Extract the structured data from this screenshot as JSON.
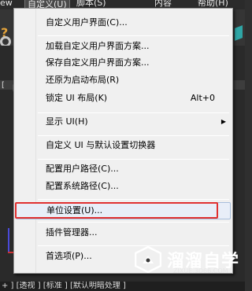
{
  "menubar": {
    "items": [
      "ew",
      "自定义(U)",
      "脚本(S)",
      "内容",
      "帮助(H)"
    ]
  },
  "viewport": {
    "bracket_a": "[",
    "bracket_b": "[前"
  },
  "menu": {
    "items": [
      {
        "label": "自定义用户界面(C)..."
      },
      {
        "label": "加载自定义用户界面方案..."
      },
      {
        "label": "保存自定义用户界面方案..."
      },
      {
        "label": "还原为启动布局(R)"
      },
      {
        "label": "锁定 UI 布局(K)",
        "shortcut": "Alt+0"
      },
      {
        "label": "显示 UI(H)"
      },
      {
        "label": "自定义 UI 与默认设置切换器"
      },
      {
        "label": "配置用户路径(C)..."
      },
      {
        "label": "配置系统路径(C)..."
      },
      {
        "label": "单位设置(U)..."
      },
      {
        "label": "插件管理器..."
      },
      {
        "label": "首选项(P)..."
      }
    ]
  },
  "statusbar": {
    "text": "+ ] [透视 ] [标准 ] [默认明暗处理 ]"
  },
  "watermark": {
    "title": "溜溜自学",
    "url": "ZIXUE.3D66.COM"
  },
  "colors": {
    "highlight_border": "#e03030",
    "menu_bg": "#f0f0f0"
  }
}
